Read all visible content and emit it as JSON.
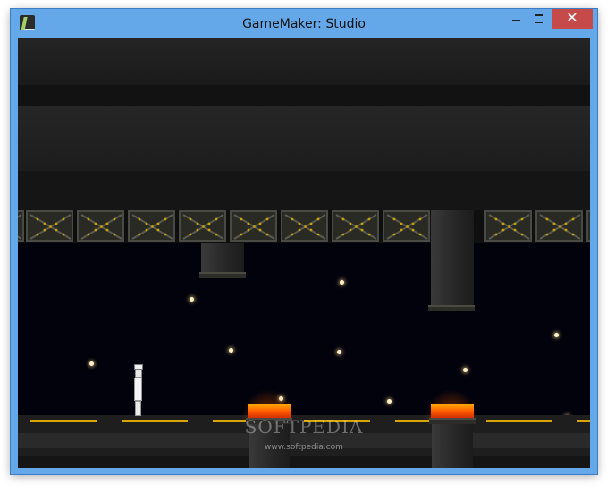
{
  "window": {
    "title": "GameMaker: Studio",
    "controls": {
      "minimize": "",
      "maximize": "",
      "close": "✕"
    }
  },
  "icons": {
    "app": "gamemaker-icon",
    "minimize": "minimize-icon",
    "maximize": "maximize-icon",
    "close": "close-icon"
  },
  "colors": {
    "window_frame": "#64a8ea",
    "close_button": "#c74a4a",
    "sky": "#02020c",
    "lava": "#ff6a00",
    "floor_stripe": "#d8a400"
  },
  "watermark": {
    "brand": "SOFTPEDIA",
    "url": "www.softpedia.com"
  },
  "scene": {
    "player": "player-character",
    "hazards": [
      "lava-pit-left",
      "lava-pit-right"
    ]
  }
}
